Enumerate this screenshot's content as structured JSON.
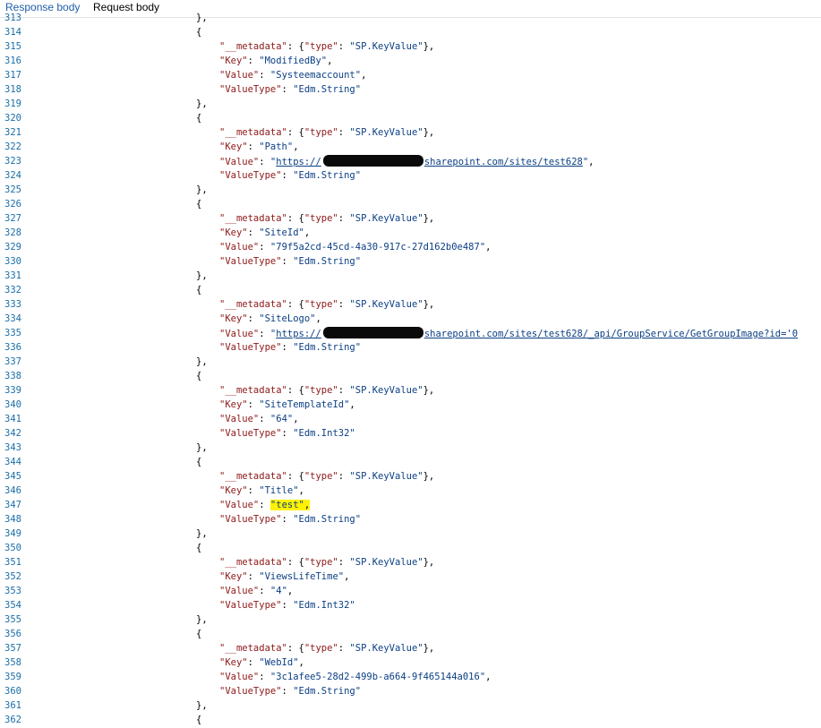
{
  "tabs": {
    "response_body": "Response body",
    "request_body": "Request body"
  },
  "highlight_color": "#fff200",
  "lines": [
    {
      "n": "313",
      "parts": [
        {
          "c": "p",
          "t": "},"
        }
      ]
    },
    {
      "n": "314",
      "parts": [
        {
          "c": "p",
          "t": "{"
        }
      ]
    },
    {
      "n": "315",
      "parts": [
        {
          "c": "k",
          "t": "\"__metadata\""
        },
        {
          "c": "p",
          "t": ": {"
        },
        {
          "c": "k",
          "t": "\"type\""
        },
        {
          "c": "p",
          "t": ": "
        },
        {
          "c": "s",
          "t": "\"SP.KeyValue\""
        },
        {
          "c": "p",
          "t": "},"
        }
      ]
    },
    {
      "n": "316",
      "parts": [
        {
          "c": "k",
          "t": "\"Key\""
        },
        {
          "c": "p",
          "t": ": "
        },
        {
          "c": "s",
          "t": "\"ModifiedBy\""
        },
        {
          "c": "p",
          "t": ","
        }
      ]
    },
    {
      "n": "317",
      "parts": [
        {
          "c": "k",
          "t": "\"Value\""
        },
        {
          "c": "p",
          "t": ": "
        },
        {
          "c": "s",
          "t": "\"Systeemaccount\""
        },
        {
          "c": "p",
          "t": ","
        }
      ]
    },
    {
      "n": "318",
      "parts": [
        {
          "c": "k",
          "t": "\"ValueType\""
        },
        {
          "c": "p",
          "t": ": "
        },
        {
          "c": "s",
          "t": "\"Edm.String\""
        }
      ]
    },
    {
      "n": "319",
      "parts": [
        {
          "c": "p",
          "t": "},"
        }
      ]
    },
    {
      "n": "320",
      "parts": [
        {
          "c": "p",
          "t": "{"
        }
      ]
    },
    {
      "n": "321",
      "parts": [
        {
          "c": "k",
          "t": "\"__metadata\""
        },
        {
          "c": "p",
          "t": ": {"
        },
        {
          "c": "k",
          "t": "\"type\""
        },
        {
          "c": "p",
          "t": ": "
        },
        {
          "c": "s",
          "t": "\"SP.KeyValue\""
        },
        {
          "c": "p",
          "t": "},"
        }
      ]
    },
    {
      "n": "322",
      "parts": [
        {
          "c": "k",
          "t": "\"Key\""
        },
        {
          "c": "p",
          "t": ": "
        },
        {
          "c": "s",
          "t": "\"Path\""
        },
        {
          "c": "p",
          "t": ","
        }
      ]
    },
    {
      "n": "323",
      "parts": [
        {
          "c": "k",
          "t": "\"Value\""
        },
        {
          "c": "p",
          "t": ": "
        },
        {
          "c": "s",
          "t": "\""
        },
        {
          "c": "s u",
          "t": "https://"
        },
        {
          "c": "redact",
          "t": "          "
        },
        {
          "c": "s u",
          "t": "sharepoint.com/sites/test628"
        },
        {
          "c": "s",
          "t": "\""
        },
        {
          "c": "p",
          "t": ","
        }
      ]
    },
    {
      "n": "324",
      "parts": [
        {
          "c": "k",
          "t": "\"ValueType\""
        },
        {
          "c": "p",
          "t": ": "
        },
        {
          "c": "s",
          "t": "\"Edm.String\""
        }
      ]
    },
    {
      "n": "325",
      "parts": [
        {
          "c": "p",
          "t": "},"
        }
      ]
    },
    {
      "n": "326",
      "parts": [
        {
          "c": "p",
          "t": "{"
        }
      ]
    },
    {
      "n": "327",
      "parts": [
        {
          "c": "k",
          "t": "\"__metadata\""
        },
        {
          "c": "p",
          "t": ": {"
        },
        {
          "c": "k",
          "t": "\"type\""
        },
        {
          "c": "p",
          "t": ": "
        },
        {
          "c": "s",
          "t": "\"SP.KeyValue\""
        },
        {
          "c": "p",
          "t": "},"
        }
      ]
    },
    {
      "n": "328",
      "parts": [
        {
          "c": "k",
          "t": "\"Key\""
        },
        {
          "c": "p",
          "t": ": "
        },
        {
          "c": "s",
          "t": "\"SiteId\""
        },
        {
          "c": "p",
          "t": ","
        }
      ]
    },
    {
      "n": "329",
      "parts": [
        {
          "c": "k",
          "t": "\"Value\""
        },
        {
          "c": "p",
          "t": ": "
        },
        {
          "c": "s",
          "t": "\"79f5a2cd-45cd-4a30-917c-27d162b0e487\""
        },
        {
          "c": "p",
          "t": ","
        }
      ]
    },
    {
      "n": "330",
      "parts": [
        {
          "c": "k",
          "t": "\"ValueType\""
        },
        {
          "c": "p",
          "t": ": "
        },
        {
          "c": "s",
          "t": "\"Edm.String\""
        }
      ]
    },
    {
      "n": "331",
      "parts": [
        {
          "c": "p",
          "t": "},"
        }
      ]
    },
    {
      "n": "332",
      "parts": [
        {
          "c": "p",
          "t": "{"
        }
      ]
    },
    {
      "n": "333",
      "parts": [
        {
          "c": "k",
          "t": "\"__metadata\""
        },
        {
          "c": "p",
          "t": ": {"
        },
        {
          "c": "k",
          "t": "\"type\""
        },
        {
          "c": "p",
          "t": ": "
        },
        {
          "c": "s",
          "t": "\"SP.KeyValue\""
        },
        {
          "c": "p",
          "t": "},"
        }
      ]
    },
    {
      "n": "334",
      "parts": [
        {
          "c": "k",
          "t": "\"Key\""
        },
        {
          "c": "p",
          "t": ": "
        },
        {
          "c": "s",
          "t": "\"SiteLogo\""
        },
        {
          "c": "p",
          "t": ","
        }
      ]
    },
    {
      "n": "335",
      "parts": [
        {
          "c": "k",
          "t": "\"Value\""
        },
        {
          "c": "p",
          "t": ": "
        },
        {
          "c": "s",
          "t": "\""
        },
        {
          "c": "s u",
          "t": "https://"
        },
        {
          "c": "redact",
          "t": "          "
        },
        {
          "c": "s u",
          "t": "sharepoint.com/sites/test628/_api/GroupService/GetGroupImage?id='0"
        }
      ]
    },
    {
      "n": "336",
      "parts": [
        {
          "c": "k",
          "t": "\"ValueType\""
        },
        {
          "c": "p",
          "t": ": "
        },
        {
          "c": "s",
          "t": "\"Edm.String\""
        }
      ]
    },
    {
      "n": "337",
      "parts": [
        {
          "c": "p",
          "t": "},"
        }
      ]
    },
    {
      "n": "338",
      "parts": [
        {
          "c": "p",
          "t": "{"
        }
      ]
    },
    {
      "n": "339",
      "parts": [
        {
          "c": "k",
          "t": "\"__metadata\""
        },
        {
          "c": "p",
          "t": ": {"
        },
        {
          "c": "k",
          "t": "\"type\""
        },
        {
          "c": "p",
          "t": ": "
        },
        {
          "c": "s",
          "t": "\"SP.KeyValue\""
        },
        {
          "c": "p",
          "t": "},"
        }
      ]
    },
    {
      "n": "340",
      "parts": [
        {
          "c": "k",
          "t": "\"Key\""
        },
        {
          "c": "p",
          "t": ": "
        },
        {
          "c": "s",
          "t": "\"SiteTemplateId\""
        },
        {
          "c": "p",
          "t": ","
        }
      ]
    },
    {
      "n": "341",
      "parts": [
        {
          "c": "k",
          "t": "\"Value\""
        },
        {
          "c": "p",
          "t": ": "
        },
        {
          "c": "s",
          "t": "\"64\""
        },
        {
          "c": "p",
          "t": ","
        }
      ]
    },
    {
      "n": "342",
      "parts": [
        {
          "c": "k",
          "t": "\"ValueType\""
        },
        {
          "c": "p",
          "t": ": "
        },
        {
          "c": "s",
          "t": "\"Edm.Int32\""
        }
      ]
    },
    {
      "n": "343",
      "parts": [
        {
          "c": "p",
          "t": "},"
        }
      ]
    },
    {
      "n": "344",
      "parts": [
        {
          "c": "p",
          "t": "{"
        }
      ]
    },
    {
      "n": "345",
      "parts": [
        {
          "c": "k",
          "t": "\"__metadata\""
        },
        {
          "c": "p",
          "t": ": {"
        },
        {
          "c": "k",
          "t": "\"type\""
        },
        {
          "c": "p",
          "t": ": "
        },
        {
          "c": "s",
          "t": "\"SP.KeyValue\""
        },
        {
          "c": "p",
          "t": "},"
        }
      ]
    },
    {
      "n": "346",
      "parts": [
        {
          "c": "k",
          "t": "\"Key\""
        },
        {
          "c": "p",
          "t": ": "
        },
        {
          "c": "s",
          "t": "\"Title\""
        },
        {
          "c": "p",
          "t": ","
        }
      ]
    },
    {
      "n": "347",
      "parts": [
        {
          "c": "k",
          "t": "\"Value\""
        },
        {
          "c": "p",
          "t": ": "
        },
        {
          "c": "s hl",
          "t": "\"test\""
        },
        {
          "c": "p hl",
          "t": ","
        }
      ]
    },
    {
      "n": "348",
      "parts": [
        {
          "c": "k",
          "t": "\"ValueType\""
        },
        {
          "c": "p",
          "t": ": "
        },
        {
          "c": "s",
          "t": "\"Edm.String\""
        }
      ]
    },
    {
      "n": "349",
      "parts": [
        {
          "c": "p",
          "t": "},"
        }
      ]
    },
    {
      "n": "350",
      "parts": [
        {
          "c": "p",
          "t": "{"
        }
      ]
    },
    {
      "n": "351",
      "parts": [
        {
          "c": "k",
          "t": "\"__metadata\""
        },
        {
          "c": "p",
          "t": ": {"
        },
        {
          "c": "k",
          "t": "\"type\""
        },
        {
          "c": "p",
          "t": ": "
        },
        {
          "c": "s",
          "t": "\"SP.KeyValue\""
        },
        {
          "c": "p",
          "t": "},"
        }
      ]
    },
    {
      "n": "352",
      "parts": [
        {
          "c": "k",
          "t": "\"Key\""
        },
        {
          "c": "p",
          "t": ": "
        },
        {
          "c": "s",
          "t": "\"ViewsLifeTime\""
        },
        {
          "c": "p",
          "t": ","
        }
      ]
    },
    {
      "n": "353",
      "parts": [
        {
          "c": "k",
          "t": "\"Value\""
        },
        {
          "c": "p",
          "t": ": "
        },
        {
          "c": "s",
          "t": "\"4\""
        },
        {
          "c": "p",
          "t": ","
        }
      ]
    },
    {
      "n": "354",
      "parts": [
        {
          "c": "k",
          "t": "\"ValueType\""
        },
        {
          "c": "p",
          "t": ": "
        },
        {
          "c": "s",
          "t": "\"Edm.Int32\""
        }
      ]
    },
    {
      "n": "355",
      "parts": [
        {
          "c": "p",
          "t": "},"
        }
      ]
    },
    {
      "n": "356",
      "parts": [
        {
          "c": "p",
          "t": "{"
        }
      ]
    },
    {
      "n": "357",
      "parts": [
        {
          "c": "k",
          "t": "\"__metadata\""
        },
        {
          "c": "p",
          "t": ": {"
        },
        {
          "c": "k",
          "t": "\"type\""
        },
        {
          "c": "p",
          "t": ": "
        },
        {
          "c": "s",
          "t": "\"SP.KeyValue\""
        },
        {
          "c": "p",
          "t": "},"
        }
      ]
    },
    {
      "n": "358",
      "parts": [
        {
          "c": "k",
          "t": "\"Key\""
        },
        {
          "c": "p",
          "t": ": "
        },
        {
          "c": "s",
          "t": "\"WebId\""
        },
        {
          "c": "p",
          "t": ","
        }
      ]
    },
    {
      "n": "359",
      "parts": [
        {
          "c": "k",
          "t": "\"Value\""
        },
        {
          "c": "p",
          "t": ": "
        },
        {
          "c": "s",
          "t": "\"3c1afee5-28d2-499b-a664-9f465144a016\""
        },
        {
          "c": "p",
          "t": ","
        }
      ]
    },
    {
      "n": "360",
      "parts": [
        {
          "c": "k",
          "t": "\"ValueType\""
        },
        {
          "c": "p",
          "t": ": "
        },
        {
          "c": "s",
          "t": "\"Edm.String\""
        }
      ]
    },
    {
      "n": "361",
      "parts": [
        {
          "c": "p",
          "t": "},"
        }
      ]
    },
    {
      "n": "362",
      "parts": [
        {
          "c": "p",
          "t": "{"
        }
      ]
    }
  ]
}
